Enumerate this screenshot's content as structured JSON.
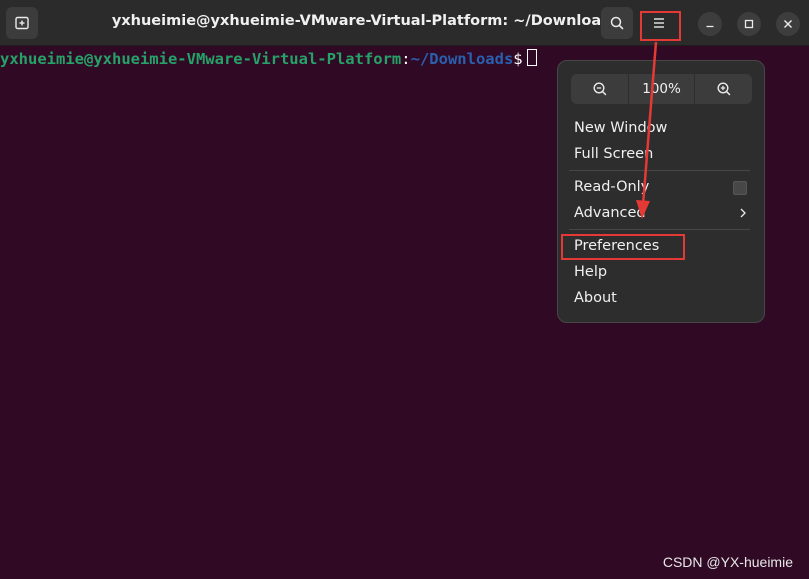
{
  "window": {
    "title": "yxhueimie@yxhueimie-VMware-Virtual-Platform: ~/Downloads"
  },
  "terminal": {
    "user_host": "yxhueimie@yxhueimie-VMware-Virtual-Platform",
    "colon": ":",
    "path": "~/Downloads",
    "dollar": "$"
  },
  "menu": {
    "zoom_level": "100%",
    "items": [
      {
        "label": "New Window"
      },
      {
        "label": "Full Screen"
      },
      {
        "label": "Read-Only"
      },
      {
        "label": "Advanced"
      },
      {
        "label": "Preferences"
      },
      {
        "label": "Help"
      },
      {
        "label": "About"
      }
    ]
  },
  "icons": {
    "new_tab": "new-tab-icon",
    "search": "search-icon",
    "menu": "hamburger-menu-icon",
    "minimize": "minimize-icon",
    "maximize": "maximize-icon",
    "close": "close-icon",
    "zoom_out": "zoom-out-icon",
    "zoom_in": "zoom-in-icon",
    "chevron": "chevron-right-icon"
  },
  "colors": {
    "terminal_background": "#300a24",
    "user_host": "#26a269",
    "path": "#2a5fb0",
    "annotation": "#e53935"
  },
  "watermark": "CSDN @YX-hueimie"
}
